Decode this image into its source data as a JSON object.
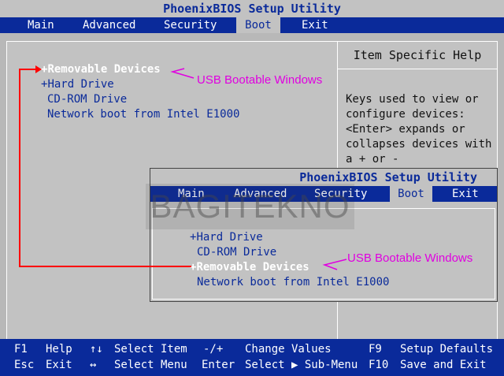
{
  "window": {
    "title": "PhoenixBIOS Setup Utility",
    "menu": [
      "Main",
      "Advanced",
      "Security",
      "Boot",
      "Exit"
    ],
    "active_tab": "Boot"
  },
  "boot_list": [
    {
      "marker": "+",
      "label": "Removable Devices"
    },
    {
      "marker": "+",
      "label": "Hard Drive"
    },
    {
      "marker": "",
      "label": "CD-ROM Drive"
    },
    {
      "marker": "",
      "label": "Network boot from Intel E1000"
    }
  ],
  "help": {
    "title": "Item Specific Help",
    "lines": [
      "Keys used to view or",
      "configure devices:",
      "<Enter> expands or",
      "collapses devices with",
      "a + or -"
    ]
  },
  "inset": {
    "title": "PhoenixBIOS Setup Utility",
    "menu": [
      "Main",
      "Advanced",
      "Security",
      "Boot",
      "Exit"
    ],
    "boot_list": [
      {
        "marker": "+",
        "label": "Hard Drive"
      },
      {
        "marker": "",
        "label": "CD-ROM Drive"
      },
      {
        "marker": "+",
        "label": "Removable Devices"
      },
      {
        "marker": "",
        "label": "Network boot from Intel E1000"
      }
    ]
  },
  "watermark": "BAGITEKNO",
  "annotations": {
    "top": "USB Bootable Windows",
    "bottom": "USB Bootable Windows",
    "color": "#e000e0",
    "arrow_color": "#ff0000"
  },
  "footer": [
    {
      "key": "F1",
      "label": "Help"
    },
    {
      "key": "↑↓",
      "label": "Select Item"
    },
    {
      "key": "-/+",
      "label": "Change Values"
    },
    {
      "key": "F9",
      "label": "Setup Defaults"
    },
    {
      "key": "Esc",
      "label": "Exit"
    },
    {
      "key": "↔",
      "label": "Select Menu"
    },
    {
      "key": "Enter",
      "label": "Select ▶ Sub-Menu"
    },
    {
      "key": "F10",
      "label": "Save and Exit"
    }
  ],
  "colors": {
    "bios_blue": "#0a2a9a",
    "bios_gray": "#c2c2c2",
    "selected_text": "#ffffff"
  }
}
